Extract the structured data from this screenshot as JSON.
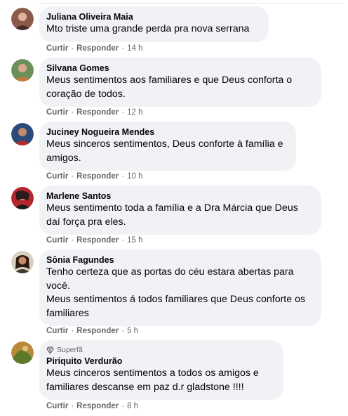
{
  "actions": {
    "like": "Curtir",
    "reply": "Responder",
    "dot": "·"
  },
  "comments": [
    {
      "author": "Juliana Oliveira Maia",
      "text": "Mto triste uma grande perda pra nova serrana",
      "time": "14 h",
      "avatar_color": "#8a5a4a"
    },
    {
      "author": "Silvana Gomes",
      "text": "Meus sentimentos aos familiares e que Deus conforta o coração de todos.",
      "time": "12 h",
      "avatar_color": "#6b8f5a"
    },
    {
      "author": "Juciney Nogueira Mendes",
      "text": "Meus sinceros sentimentos, Deus conforte à família e amigos.",
      "time": "10 h",
      "avatar_color": "#7a3a3a"
    },
    {
      "author": "Marlene Santos",
      "text": "Meus sentimento toda a família e a Dra Márcia que Deus daí força pra eles.",
      "time": "15 h",
      "avatar_color": "#b3262d"
    },
    {
      "author": "Sônia Fagundes",
      "text": "Tenho certeza que as portas do céu estara abertas para você.",
      "text2": "Meus sentimentos á todos familiares que Deus conforte os familiares",
      "time": "5 h",
      "avatar_color": "#3a3a2a"
    },
    {
      "badge": "Superfã",
      "author": "Piriquito Verdurão",
      "text": "Meus cinceros sentimentos a todos os amigos e familiares descanse em paz d.r gladstone !!!!",
      "time": "8 h",
      "avatar_color": "#b88a3a"
    }
  ]
}
